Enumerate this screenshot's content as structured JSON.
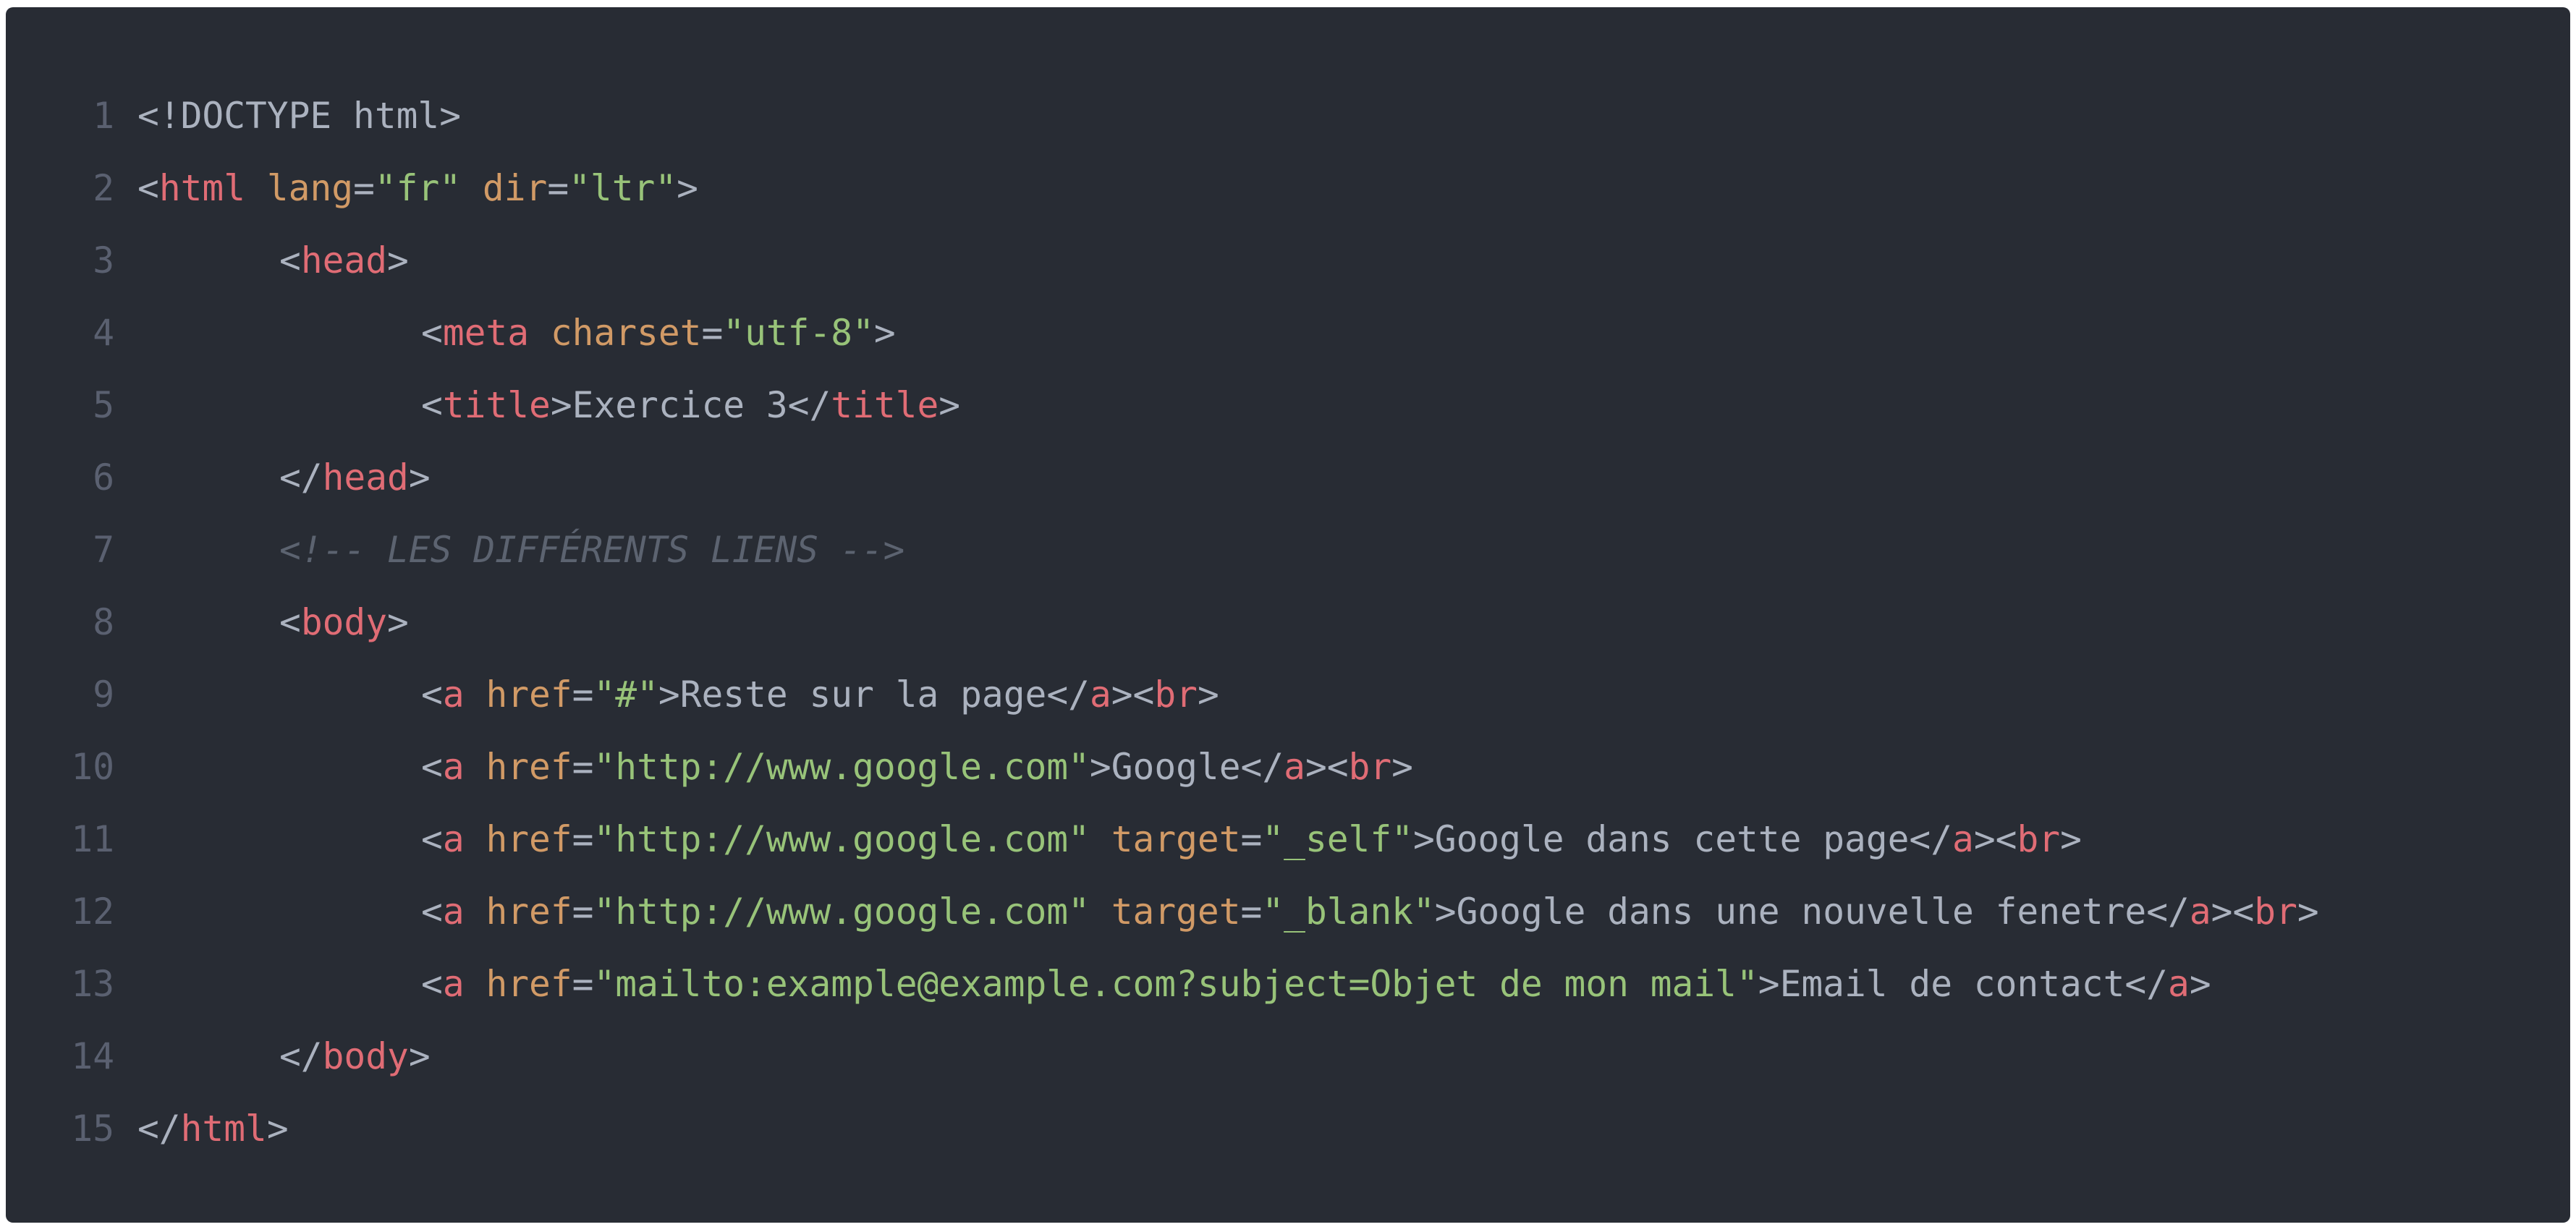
{
  "editor": {
    "language": "html",
    "theme_colors": {
      "background": "#282c34",
      "tag": "#e06c75",
      "attribute": "#d19a66",
      "string": "#98c379",
      "text": "#abb2bf",
      "comment": "#5c6370",
      "line_number": "#5a6070"
    },
    "lines": [
      {
        "number": "1",
        "indent": 0,
        "tokens": [
          [
            "punc",
            "<!DOCTYPE html>"
          ]
        ]
      },
      {
        "number": "2",
        "indent": 0,
        "tokens": [
          [
            "punc",
            "<"
          ],
          [
            "tag",
            "html"
          ],
          [
            "punc",
            " "
          ],
          [
            "attr",
            "lang"
          ],
          [
            "punc",
            "="
          ],
          [
            "str",
            "\"fr\""
          ],
          [
            "punc",
            " "
          ],
          [
            "attr",
            "dir"
          ],
          [
            "punc",
            "="
          ],
          [
            "str",
            "\"ltr\""
          ],
          [
            "punc",
            ">"
          ]
        ]
      },
      {
        "number": "3",
        "indent": 1,
        "tokens": [
          [
            "punc",
            "<"
          ],
          [
            "tag",
            "head"
          ],
          [
            "punc",
            ">"
          ]
        ]
      },
      {
        "number": "4",
        "indent": 2,
        "tokens": [
          [
            "punc",
            "<"
          ],
          [
            "tag",
            "meta"
          ],
          [
            "punc",
            " "
          ],
          [
            "attr",
            "charset"
          ],
          [
            "punc",
            "="
          ],
          [
            "str",
            "\"utf-8\""
          ],
          [
            "punc",
            ">"
          ]
        ]
      },
      {
        "number": "5",
        "indent": 2,
        "tokens": [
          [
            "punc",
            "<"
          ],
          [
            "tag",
            "title"
          ],
          [
            "punc",
            ">"
          ],
          [
            "txt",
            "Exercice 3"
          ],
          [
            "punc",
            "</"
          ],
          [
            "tag",
            "title"
          ],
          [
            "punc",
            ">"
          ]
        ]
      },
      {
        "number": "6",
        "indent": 1,
        "tokens": [
          [
            "punc",
            "</"
          ],
          [
            "tag",
            "head"
          ],
          [
            "punc",
            ">"
          ]
        ]
      },
      {
        "number": "7",
        "indent": 1,
        "tokens": [
          [
            "cmt",
            "<!-- LES DIFFÉRENTS LIENS -->"
          ]
        ]
      },
      {
        "number": "8",
        "indent": 1,
        "tokens": [
          [
            "punc",
            "<"
          ],
          [
            "tag",
            "body"
          ],
          [
            "punc",
            ">"
          ]
        ]
      },
      {
        "number": "9",
        "indent": 2,
        "tokens": [
          [
            "punc",
            "<"
          ],
          [
            "tag",
            "a"
          ],
          [
            "punc",
            " "
          ],
          [
            "attr",
            "href"
          ],
          [
            "punc",
            "="
          ],
          [
            "str",
            "\"#\""
          ],
          [
            "punc",
            ">"
          ],
          [
            "txt",
            "Reste sur la page"
          ],
          [
            "punc",
            "</"
          ],
          [
            "tag",
            "a"
          ],
          [
            "punc",
            "><"
          ],
          [
            "tag",
            "br"
          ],
          [
            "punc",
            ">"
          ]
        ]
      },
      {
        "number": "10",
        "indent": 2,
        "tokens": [
          [
            "punc",
            "<"
          ],
          [
            "tag",
            "a"
          ],
          [
            "punc",
            " "
          ],
          [
            "attr",
            "href"
          ],
          [
            "punc",
            "="
          ],
          [
            "str",
            "\"http://www.google.com\""
          ],
          [
            "punc",
            ">"
          ],
          [
            "txt",
            "Google"
          ],
          [
            "punc",
            "</"
          ],
          [
            "tag",
            "a"
          ],
          [
            "punc",
            "><"
          ],
          [
            "tag",
            "br"
          ],
          [
            "punc",
            ">"
          ]
        ]
      },
      {
        "number": "11",
        "indent": 2,
        "tokens": [
          [
            "punc",
            "<"
          ],
          [
            "tag",
            "a"
          ],
          [
            "punc",
            " "
          ],
          [
            "attr",
            "href"
          ],
          [
            "punc",
            "="
          ],
          [
            "str",
            "\"http://www.google.com\""
          ],
          [
            "punc",
            " "
          ],
          [
            "attr",
            "target"
          ],
          [
            "punc",
            "="
          ],
          [
            "str",
            "\"_self\""
          ],
          [
            "punc",
            ">"
          ],
          [
            "txt",
            "Google dans cette page"
          ],
          [
            "punc",
            "</"
          ],
          [
            "tag",
            "a"
          ],
          [
            "punc",
            "><"
          ],
          [
            "tag",
            "br"
          ],
          [
            "punc",
            ">"
          ]
        ]
      },
      {
        "number": "12",
        "indent": 2,
        "tokens": [
          [
            "punc",
            "<"
          ],
          [
            "tag",
            "a"
          ],
          [
            "punc",
            " "
          ],
          [
            "attr",
            "href"
          ],
          [
            "punc",
            "="
          ],
          [
            "str",
            "\"http://www.google.com\""
          ],
          [
            "punc",
            " "
          ],
          [
            "attr",
            "target"
          ],
          [
            "punc",
            "="
          ],
          [
            "str",
            "\"_blank\""
          ],
          [
            "punc",
            ">"
          ],
          [
            "txt",
            "Google dans une nouvelle fenetre"
          ],
          [
            "punc",
            "</"
          ],
          [
            "tag",
            "a"
          ],
          [
            "punc",
            "><"
          ],
          [
            "tag",
            "br"
          ],
          [
            "punc",
            ">"
          ]
        ]
      },
      {
        "number": "13",
        "indent": 2,
        "tokens": [
          [
            "punc",
            "<"
          ],
          [
            "tag",
            "a"
          ],
          [
            "punc",
            " "
          ],
          [
            "attr",
            "href"
          ],
          [
            "punc",
            "="
          ],
          [
            "str",
            "\"mailto:example@example.com?subject=Objet de mon mail\""
          ],
          [
            "punc",
            ">"
          ],
          [
            "txt",
            "Email de contact"
          ],
          [
            "punc",
            "</"
          ],
          [
            "tag",
            "a"
          ],
          [
            "punc",
            ">"
          ]
        ]
      },
      {
        "number": "14",
        "indent": 1,
        "tokens": [
          [
            "punc",
            "</"
          ],
          [
            "tag",
            "body"
          ],
          [
            "punc",
            ">"
          ]
        ]
      },
      {
        "number": "15",
        "indent": 0,
        "tokens": [
          [
            "punc",
            "</"
          ],
          [
            "tag",
            "html"
          ],
          [
            "punc",
            ">"
          ]
        ]
      }
    ]
  }
}
